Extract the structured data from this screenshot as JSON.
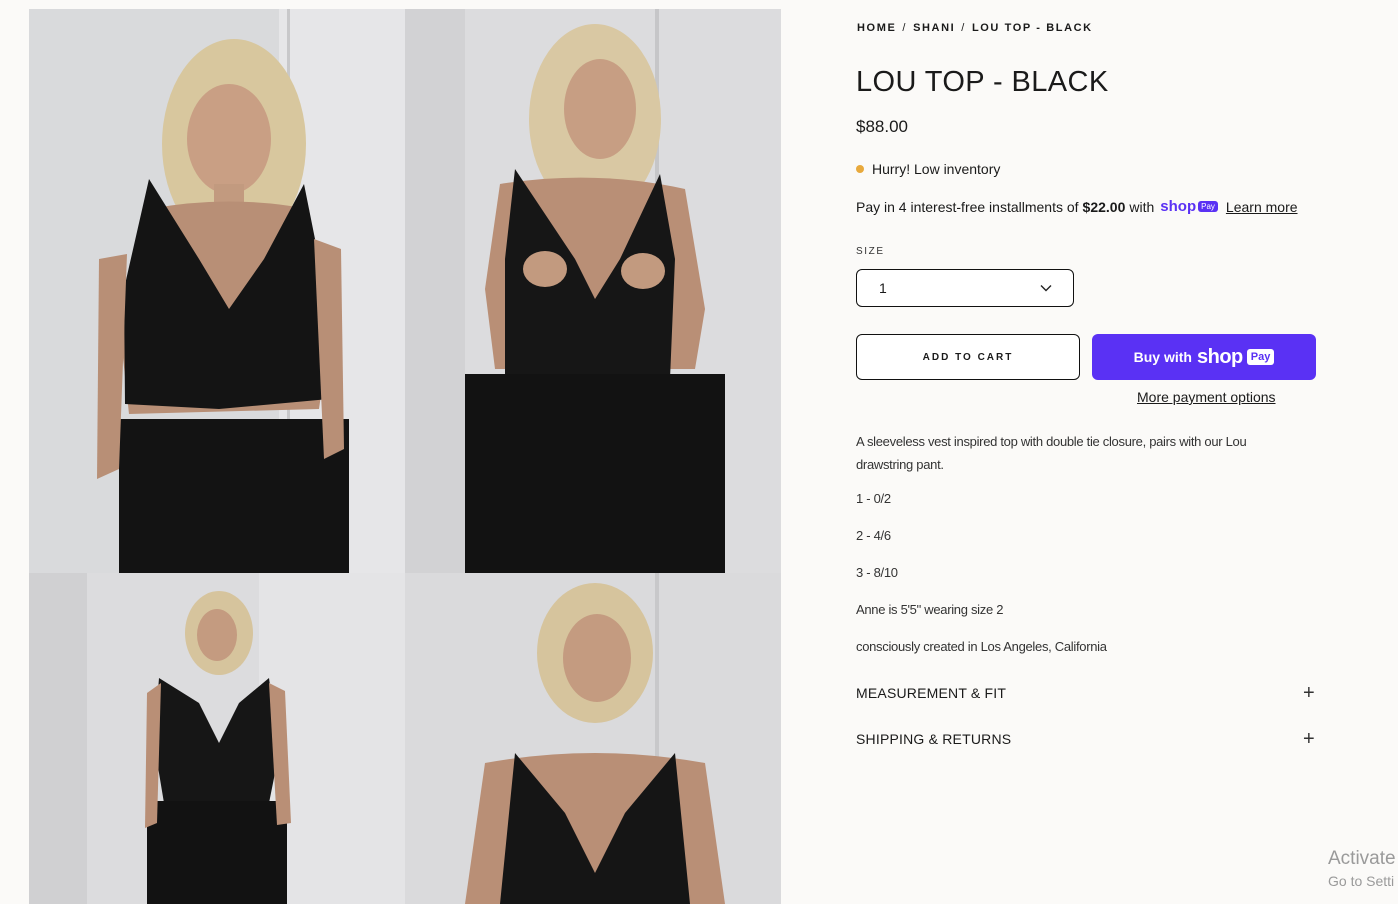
{
  "gallery": {
    "images": [
      {
        "alt": "model-front-view-icon"
      },
      {
        "alt": "model-tying-top-icon"
      },
      {
        "alt": "model-full-length-icon"
      },
      {
        "alt": "model-closeup-icon"
      }
    ]
  },
  "breadcrumb": [
    "HOME",
    "SHANI",
    "LOU TOP - BLACK"
  ],
  "breadcrumb_sep": "/",
  "product": {
    "title": "LOU TOP - BLACK",
    "price": "$88.00",
    "stock_status": "Hurry! Low inventory",
    "installments_prefix": "Pay in 4 interest-free installments of",
    "installments_amount": "$22.00",
    "installments_with": "with",
    "shop_logo": "shop",
    "shop_pay_badge": "Pay",
    "learn_more": "Learn more",
    "size_label": "SIZE",
    "size_selected": "1",
    "add_to_cart": "ADD TO CART",
    "buy_with": "Buy with",
    "buy_shop": "shop",
    "buy_pay": "Pay",
    "more_payment": "More payment options",
    "description": "A sleeveless vest inspired top with double tie closure, pairs with our Lou drawstring pant.",
    "sizes": [
      "1 - 0/2",
      "2 - 4/6",
      "3 - 8/10"
    ],
    "model_note": "Anne is 5'5\" wearing size 2",
    "origin_note": "consciously created in Los Angeles, California"
  },
  "accordions": [
    {
      "label": "MEASUREMENT & FIT",
      "icon": "plus-icon"
    },
    {
      "label": "SHIPPING & RETURNS",
      "icon": "plus-icon"
    }
  ],
  "watermark": {
    "line1": "Activate",
    "line2": "Go to Setti"
  },
  "colors": {
    "accent": "#5a31f4",
    "stock_dot": "#e8a93c",
    "background": "#fbfaf8"
  }
}
